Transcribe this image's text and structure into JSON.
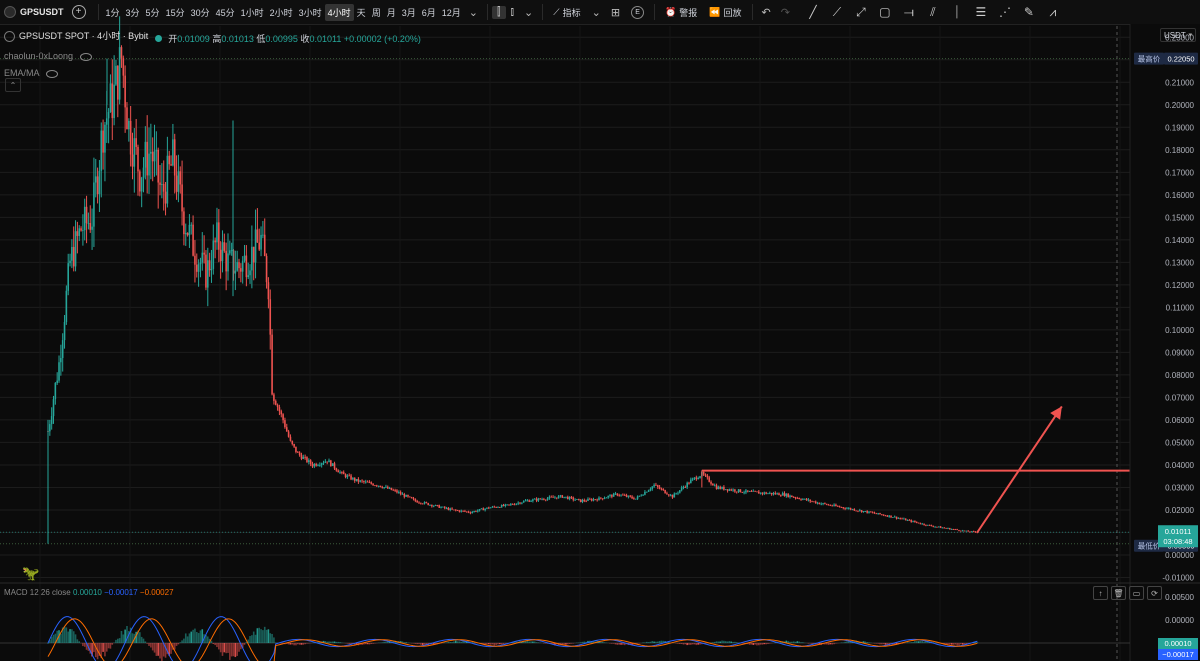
{
  "toolbar": {
    "symbol": "GPSUSDT",
    "timeframes": [
      "1分",
      "3分",
      "5分",
      "15分",
      "30分",
      "45分",
      "1小时",
      "2小时",
      "3小时",
      "4小时",
      "天",
      "周",
      "月",
      "3月",
      "6月",
      "12月"
    ],
    "active_timeframe": "4小时",
    "indicators_label": "指标",
    "alert_label": "警报",
    "replay_label": "回放",
    "e_badge": "E"
  },
  "legend": {
    "title": "GPSUSDT SPOT · 4小时 · Bybit",
    "open_label": "开",
    "open": "0.01009",
    "high_label": "高",
    "high": "0.01013",
    "low_label": "低",
    "low": "0.00995",
    "close_label": "收",
    "close": "0.01011",
    "change": "+0.00002 (+0.20%)",
    "author": "chaolun-0xLoong",
    "indicator": "EMA/MA"
  },
  "price_axis": {
    "unit": "USDT",
    "high_tag_label": "最高价",
    "high_tag_value": "0.22050",
    "low_tag_label": "最低价",
    "low_tag_value": "0.00500",
    "last_price": "0.01011",
    "countdown": "03:08:48"
  },
  "macd": {
    "label": "MACD 12 26 close",
    "hist": "0.00010",
    "macd": "−0.00017",
    "signal": "−0.00027",
    "axis_tag_1": "0.00010",
    "axis_tag_2": "−0.00017"
  },
  "colors": {
    "up": "#26a69a",
    "down": "#ef5350",
    "annotation": "#ef5350",
    "grid": "#1c1c1c",
    "background": "#0b0b0b"
  },
  "chart_data": {
    "type": "candlestick",
    "ylim": [
      -0.012,
      0.235
    ],
    "y_ticks": [
      "0.23000",
      "0.22000",
      "0.21000",
      "0.20000",
      "0.19000",
      "0.18000",
      "0.17000",
      "0.16000",
      "0.15000",
      "0.14000",
      "0.13000",
      "0.12000",
      "0.11000",
      "0.10000",
      "0.09000",
      "0.08000",
      "0.07000",
      "0.06000",
      "0.05000",
      "0.04000",
      "0.03000",
      "0.02000",
      "0.01000",
      "0.00000",
      "-0.01000"
    ],
    "price_path": [
      [
        0,
        0.055
      ],
      [
        3,
        0.085
      ],
      [
        6,
        0.13
      ],
      [
        9,
        0.145
      ],
      [
        12,
        0.15
      ],
      [
        15,
        0.19
      ],
      [
        18,
        0.205
      ],
      [
        20,
        0.221
      ],
      [
        22,
        0.19
      ],
      [
        25,
        0.17
      ],
      [
        28,
        0.18
      ],
      [
        31,
        0.16
      ],
      [
        34,
        0.175
      ],
      [
        37,
        0.15
      ],
      [
        40,
        0.135
      ],
      [
        43,
        0.125
      ],
      [
        46,
        0.14
      ],
      [
        49,
        0.13
      ],
      [
        52,
        0.128
      ],
      [
        55,
        0.133
      ],
      [
        58,
        0.14
      ],
      [
        60,
        0.12
      ],
      [
        61,
        0.075
      ],
      [
        62,
        0.068
      ],
      [
        64,
        0.06
      ],
      [
        66,
        0.05
      ],
      [
        68,
        0.045
      ],
      [
        72,
        0.04
      ],
      [
        76,
        0.042
      ],
      [
        80,
        0.036
      ],
      [
        84,
        0.033
      ],
      [
        90,
        0.031
      ],
      [
        95,
        0.028
      ],
      [
        100,
        0.024
      ],
      [
        105,
        0.022
      ],
      [
        110,
        0.02
      ],
      [
        115,
        0.019
      ],
      [
        120,
        0.021
      ],
      [
        125,
        0.022
      ],
      [
        130,
        0.024
      ],
      [
        135,
        0.025
      ],
      [
        140,
        0.026
      ],
      [
        145,
        0.024
      ],
      [
        150,
        0.025
      ],
      [
        155,
        0.027
      ],
      [
        160,
        0.025
      ],
      [
        165,
        0.031
      ],
      [
        170,
        0.026
      ],
      [
        175,
        0.033
      ],
      [
        178,
        0.036
      ],
      [
        182,
        0.03
      ],
      [
        190,
        0.028
      ],
      [
        200,
        0.027
      ],
      [
        210,
        0.023
      ],
      [
        220,
        0.02
      ],
      [
        230,
        0.017
      ],
      [
        240,
        0.013
      ],
      [
        250,
        0.0105
      ],
      [
        253,
        0.0101
      ]
    ],
    "annotations": {
      "horizontal_level": 0.0375,
      "trend_arrow_start": [
        253,
        0.0101
      ],
      "trend_arrow_end": [
        276,
        0.066
      ]
    }
  }
}
